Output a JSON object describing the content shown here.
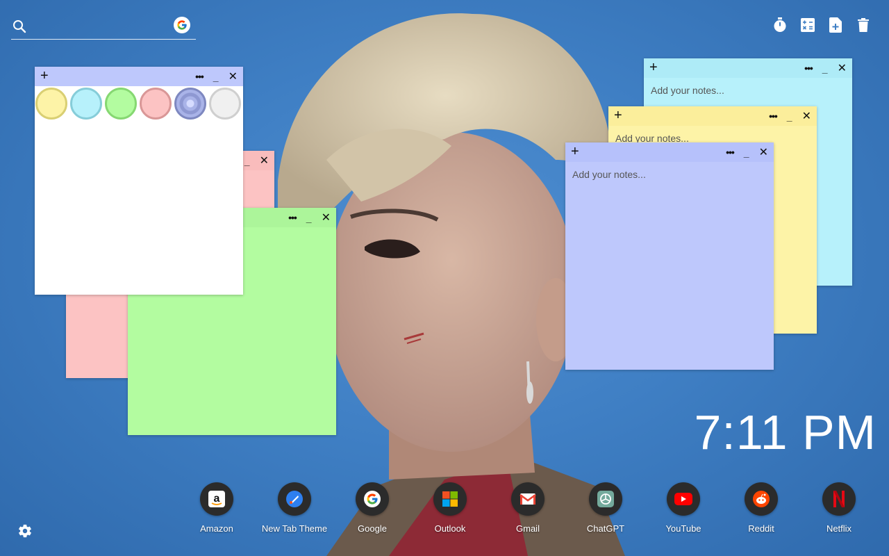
{
  "search": {
    "placeholder": "",
    "google_letter": "G"
  },
  "toolbar": {
    "timer": "timer-icon",
    "calculator": "calculator-icon",
    "new_note": "add-note-icon",
    "delete": "trash-icon"
  },
  "notes": [
    {
      "color": "#b7f1fb",
      "placeholder": "Add your notes...",
      "plus": "+",
      "more": "•••",
      "minimize": "_",
      "close": "✕"
    },
    {
      "color": "#fdf3a7",
      "placeholder": "Add your notes...",
      "plus": "+",
      "more": "•••",
      "minimize": "_",
      "close": "✕"
    },
    {
      "color": "#bec8fc",
      "placeholder": "Add your notes...",
      "plus": "+",
      "more": "•••",
      "minimize": "_",
      "close": "✕"
    },
    {
      "color": "#fcc3c3",
      "placeholder": "",
      "plus": "+",
      "more": "•••",
      "minimize": "_",
      "close": "✕"
    },
    {
      "color": "#b3fca0",
      "placeholder": "",
      "plus": "+",
      "more": "•••",
      "minimize": "_",
      "close": "✕"
    },
    {
      "color": "#ffffff",
      "placeholder": "",
      "plus": "+",
      "more": "•••",
      "minimize": "_",
      "close": "✕"
    }
  ],
  "color_options": [
    {
      "name": "yellow",
      "fill": "#fdf3a7",
      "ring": "#d9cf73"
    },
    {
      "name": "blue",
      "fill": "#b7f1fb",
      "ring": "#86cdd9"
    },
    {
      "name": "green",
      "fill": "#b3fca0",
      "ring": "#86d872"
    },
    {
      "name": "pink",
      "fill": "#fcc3c3",
      "ring": "#d99797"
    },
    {
      "name": "purple",
      "fill": "#a9b3e8",
      "ring": "#7e88c0",
      "selected": true
    },
    {
      "name": "white",
      "fill": "#f0f0f0",
      "ring": "#cfcfcf"
    }
  ],
  "clock": {
    "time": "7:11 PM"
  },
  "dock": [
    {
      "label": "Amazon",
      "icon": "amazon-icon"
    },
    {
      "label": "New Tab Theme",
      "icon": "new-tab-theme-icon"
    },
    {
      "label": "Google",
      "icon": "google-icon"
    },
    {
      "label": "Outlook",
      "icon": "outlook-icon"
    },
    {
      "label": "Gmail",
      "icon": "gmail-icon"
    },
    {
      "label": "ChatGPT",
      "icon": "chatgpt-icon"
    },
    {
      "label": "YouTube",
      "icon": "youtube-icon"
    },
    {
      "label": "Reddit",
      "icon": "reddit-icon"
    },
    {
      "label": "Netflix",
      "icon": "netflix-icon"
    }
  ],
  "settings": {
    "icon": "gear-icon"
  },
  "colors": {
    "accent_white": "#ffffff",
    "background": "#3f7fc4"
  }
}
